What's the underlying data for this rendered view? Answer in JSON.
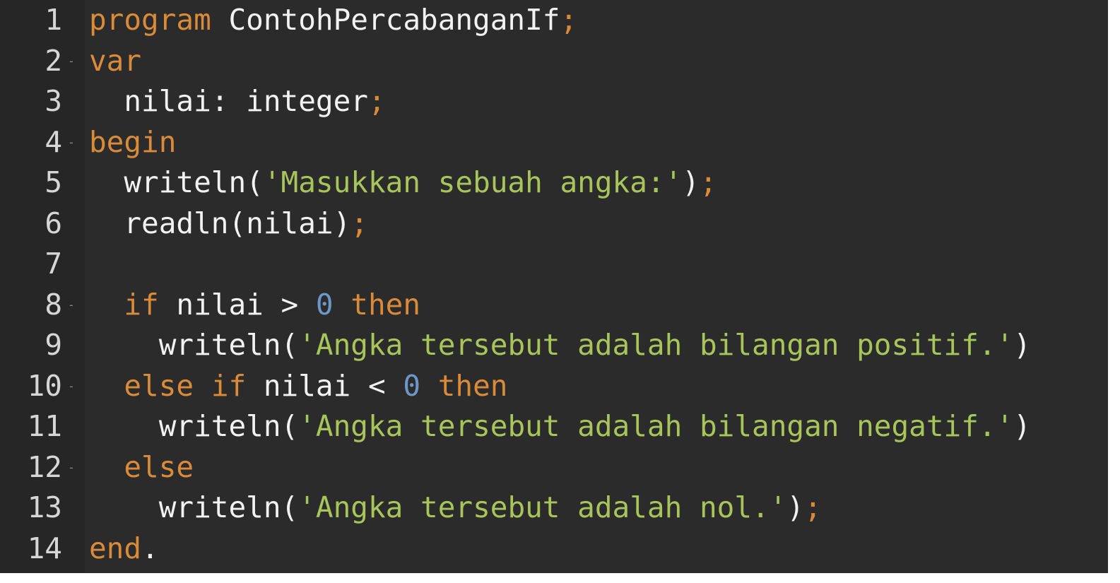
{
  "editor": {
    "colors": {
      "background": "#2b2b2b",
      "gutter": "#262626",
      "line_number": "#d6d6d6",
      "keyword": "#d98b3a",
      "identifier": "#f2f2f2",
      "string": "#a9c45a",
      "number": "#6c98c9"
    },
    "lines": [
      {
        "number": "1",
        "fold": "",
        "tokens": [
          {
            "t": "program",
            "c": "kw"
          },
          {
            "t": " ",
            "c": "ws"
          },
          {
            "t": "ContohPercabanganIf",
            "c": "id"
          },
          {
            "t": ";",
            "c": "semi"
          }
        ]
      },
      {
        "number": "2",
        "fold": "-",
        "tokens": [
          {
            "t": "var",
            "c": "kw"
          }
        ]
      },
      {
        "number": "3",
        "fold": "",
        "tokens": [
          {
            "t": "  ",
            "c": "ws"
          },
          {
            "t": "nilai: integer",
            "c": "id"
          },
          {
            "t": ";",
            "c": "semi"
          }
        ]
      },
      {
        "number": "4",
        "fold": "-",
        "tokens": [
          {
            "t": "begin",
            "c": "kw"
          }
        ]
      },
      {
        "number": "5",
        "fold": "",
        "tokens": [
          {
            "t": "  ",
            "c": "ws"
          },
          {
            "t": "writeln(",
            "c": "id"
          },
          {
            "t": "'Masukkan sebuah angka:'",
            "c": "str"
          },
          {
            "t": ")",
            "c": "punc"
          },
          {
            "t": ";",
            "c": "semi"
          }
        ]
      },
      {
        "number": "6",
        "fold": "",
        "tokens": [
          {
            "t": "  ",
            "c": "ws"
          },
          {
            "t": "readln(nilai)",
            "c": "id"
          },
          {
            "t": ";",
            "c": "semi"
          }
        ]
      },
      {
        "number": "7",
        "fold": "",
        "tokens": []
      },
      {
        "number": "8",
        "fold": "-",
        "tokens": [
          {
            "t": "  ",
            "c": "ws"
          },
          {
            "t": "if",
            "c": "kw"
          },
          {
            "t": " nilai > ",
            "c": "id"
          },
          {
            "t": "0",
            "c": "num"
          },
          {
            "t": " ",
            "c": "ws"
          },
          {
            "t": "then",
            "c": "kw"
          }
        ]
      },
      {
        "number": "9",
        "fold": "",
        "tokens": [
          {
            "t": "    ",
            "c": "ws"
          },
          {
            "t": "writeln(",
            "c": "id"
          },
          {
            "t": "'Angka tersebut adalah bilangan positif.'",
            "c": "str"
          },
          {
            "t": ")",
            "c": "punc"
          }
        ]
      },
      {
        "number": "10",
        "fold": "-",
        "tokens": [
          {
            "t": "  ",
            "c": "ws"
          },
          {
            "t": "else",
            "c": "kw"
          },
          {
            "t": " ",
            "c": "ws"
          },
          {
            "t": "if",
            "c": "kw"
          },
          {
            "t": " nilai < ",
            "c": "id"
          },
          {
            "t": "0",
            "c": "num"
          },
          {
            "t": " ",
            "c": "ws"
          },
          {
            "t": "then",
            "c": "kw"
          }
        ]
      },
      {
        "number": "11",
        "fold": "",
        "tokens": [
          {
            "t": "    ",
            "c": "ws"
          },
          {
            "t": "writeln(",
            "c": "id"
          },
          {
            "t": "'Angka tersebut adalah bilangan negatif.'",
            "c": "str"
          },
          {
            "t": ")",
            "c": "punc"
          }
        ]
      },
      {
        "number": "12",
        "fold": "-",
        "tokens": [
          {
            "t": "  ",
            "c": "ws"
          },
          {
            "t": "else",
            "c": "kw"
          }
        ]
      },
      {
        "number": "13",
        "fold": "",
        "tokens": [
          {
            "t": "    ",
            "c": "ws"
          },
          {
            "t": "writeln(",
            "c": "id"
          },
          {
            "t": "'Angka tersebut adalah nol.'",
            "c": "str"
          },
          {
            "t": ")",
            "c": "punc"
          },
          {
            "t": ";",
            "c": "semi"
          }
        ]
      },
      {
        "number": "14",
        "fold": "",
        "tokens": [
          {
            "t": "end",
            "c": "kw"
          },
          {
            "t": ".",
            "c": "punc"
          }
        ]
      }
    ]
  }
}
